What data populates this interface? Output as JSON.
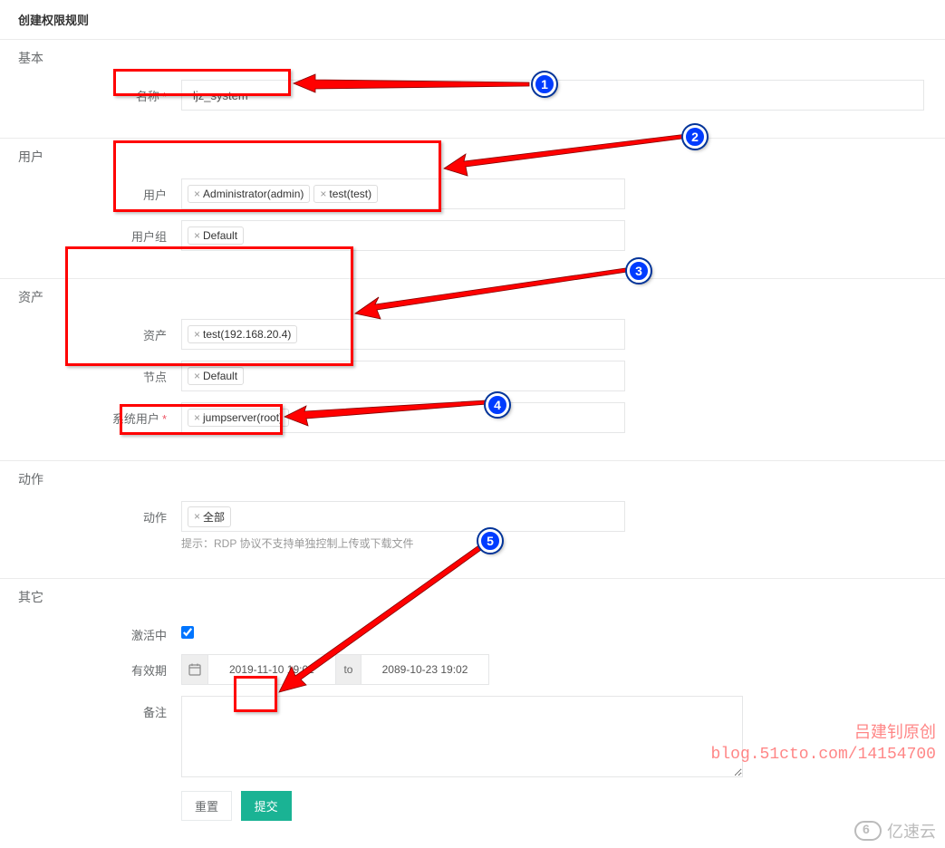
{
  "page_title": "创建权限规则",
  "sections": {
    "basic": {
      "title": "基本",
      "name_label": "名称",
      "name_value": "ljz_system"
    },
    "user": {
      "title": "用户",
      "user_label": "用户",
      "user_tags": [
        "Administrator(admin)",
        "test(test)"
      ],
      "usergroup_label": "用户组",
      "usergroup_tags": [
        "Default"
      ]
    },
    "asset": {
      "title": "资产",
      "asset_label": "资产",
      "asset_tags": [
        "test(192.168.20.4)"
      ],
      "node_label": "节点",
      "node_tags": [
        "Default"
      ],
      "sysuser_label": "系统用户",
      "sysuser_tags": [
        "jumpserver(root)"
      ]
    },
    "action": {
      "title": "动作",
      "action_label": "动作",
      "action_tags": [
        "全部"
      ],
      "hint": "提示：RDP 协议不支持单独控制上传或下载文件"
    },
    "other": {
      "title": "其它",
      "active_label": "激活中",
      "active_checked": true,
      "valid_label": "有效期",
      "date_from": "2019-11-10 19:02",
      "date_sep": "to",
      "date_to": "2089-10-23 19:02",
      "remark_label": "备注",
      "remark_value": ""
    }
  },
  "buttons": {
    "reset": "重置",
    "submit": "提交"
  },
  "annotations": {
    "badges": [
      "1",
      "2",
      "3",
      "4",
      "5"
    ]
  },
  "watermark": {
    "line1": "吕建钊原创",
    "line2": "blog.51cto.com/14154700",
    "logo_text": "亿速云"
  }
}
